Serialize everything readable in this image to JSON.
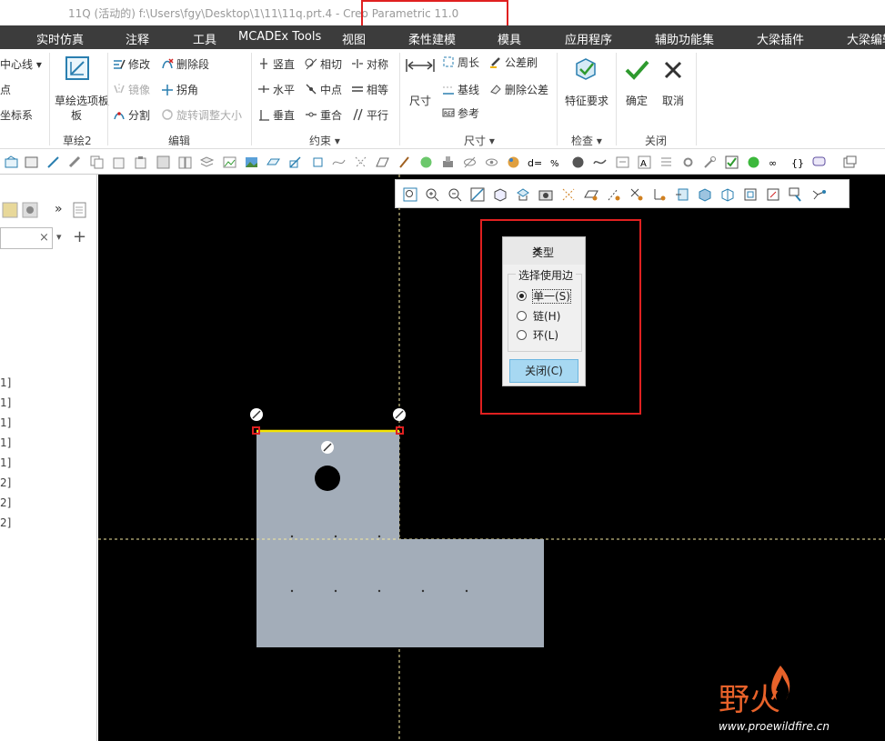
{
  "window": {
    "title_prefix": "11Q (活动的) f:\\Users\\fgy\\Desktop\\1\\11\\11q.prt.4 - ",
    "app_name": "Creo Parametric 11.0"
  },
  "menu": [
    "实时仿真",
    "注释",
    "工具",
    "MCADEx Tools",
    "视图",
    "柔性建模",
    "模具",
    "应用程序",
    "辅助功能集",
    "大梁插件",
    "大梁编辑"
  ],
  "ribbon": {
    "left_partial": [
      "中心线",
      "点",
      "坐标系"
    ],
    "sketch_panel_button": "草绘选项板",
    "sketch_panel_button_line2": "板",
    "group_sketch": "草绘2",
    "edit": [
      "修改",
      "删除段",
      "镜像",
      "拐角",
      "分割",
      "旋转调整大小"
    ],
    "group_edit": "编辑",
    "constrain": [
      "竖直",
      "相切",
      "对称",
      "水平",
      "中点",
      "相等",
      "垂直",
      "重合",
      "平行"
    ],
    "group_constrain": "约束",
    "dim_button": "尺寸",
    "dim": [
      "周长",
      "公差刷",
      "基线",
      "删除公差",
      "参考"
    ],
    "group_dim": "尺寸",
    "inspect_button": "特征要求",
    "group_inspect": "检查",
    "ok": "确定",
    "cancel": "取消",
    "group_close": "关闭"
  },
  "left_panel": {
    "more": "»",
    "items": [
      "1]",
      "1]",
      "1]",
      "1]",
      "1]",
      "2]",
      "2]",
      "2]"
    ]
  },
  "dialog": {
    "title": "类型",
    "group_label": "选择使用边",
    "options": [
      "单一(S)",
      "链(H)",
      "环(L)"
    ],
    "selected": 0,
    "close_button": "关闭(C)"
  },
  "watermark": {
    "logo_text": "野火",
    "url": "www.proewildfire.cn"
  },
  "colors": {
    "menu_bg": "#3c3c3c",
    "viewport_bg": "#000000",
    "part_fill": "#a3adb9",
    "highlight_red": "#e02020",
    "selected_edge": "#f5e400",
    "dialog_button": "#a7d8f2",
    "accent_orange": "#e8622a"
  }
}
